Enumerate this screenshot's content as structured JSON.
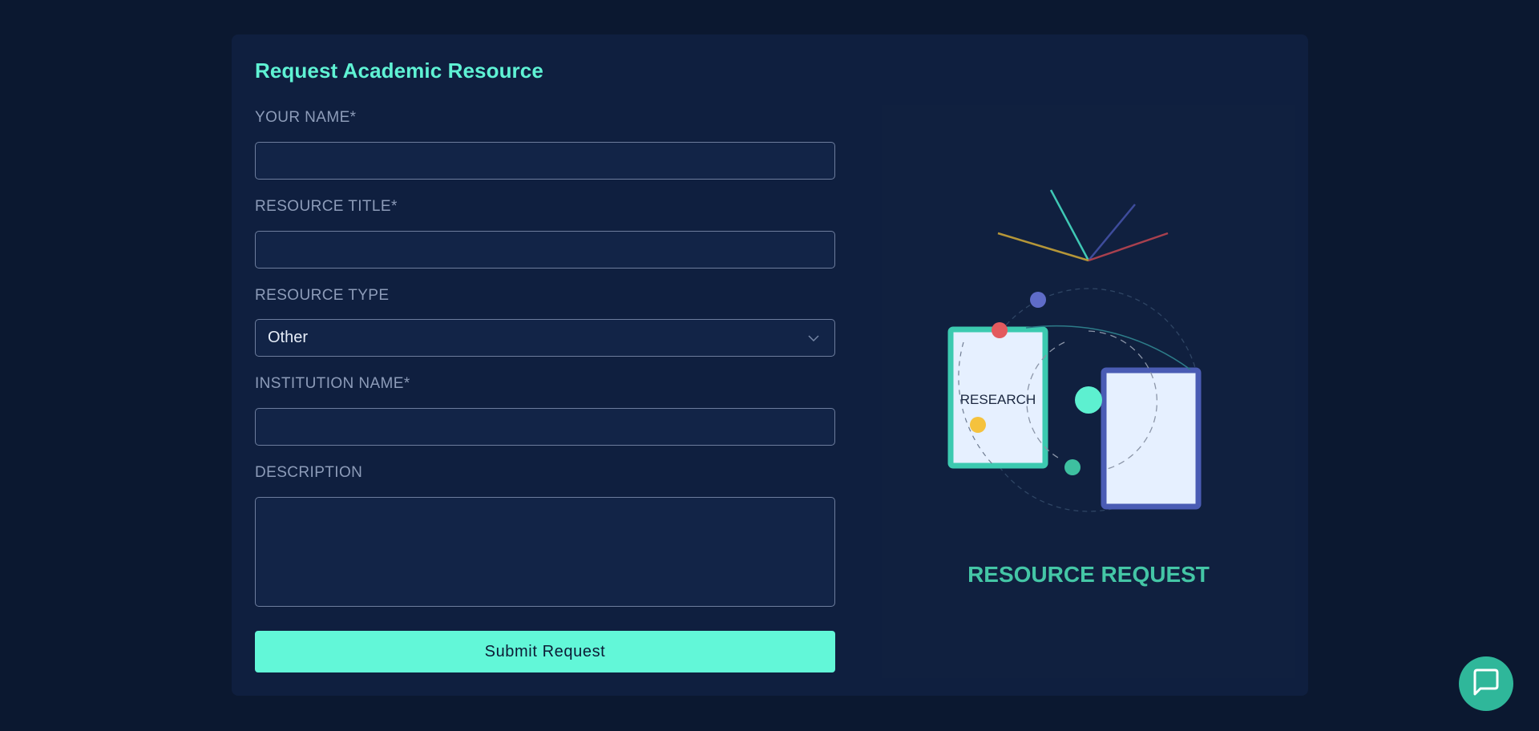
{
  "form": {
    "title": "Request Academic Resource",
    "fields": [
      {
        "label": "YOUR NAME*",
        "value": ""
      },
      {
        "label": "RESOURCE TITLE*",
        "value": ""
      },
      {
        "label": "RESOURCE TYPE",
        "value": "Other"
      },
      {
        "label": "INSTITUTION NAME*",
        "value": ""
      },
      {
        "label": "DESCRIPTION",
        "value": ""
      }
    ],
    "submit_label": "Submit Request"
  },
  "illustration": {
    "book_label": "RESEARCH",
    "caption": "RESOURCE REQUEST"
  },
  "chat": {
    "icon": "chat-bubble-icon"
  },
  "colors": {
    "background": "#0b1830",
    "card": "#0f1f3f",
    "accent": "#62f7d8",
    "caption": "#44c6a6"
  }
}
